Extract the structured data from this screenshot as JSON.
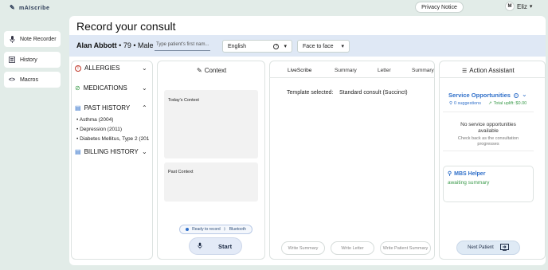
{
  "app": {
    "logo_text": "mAIscribe",
    "privacy_label": "Privacy Notice",
    "user_initial": "M",
    "user_name": "Eliz"
  },
  "sidebar": {
    "items": [
      {
        "label": "Note Recorder",
        "icon": "mic-icon"
      },
      {
        "label": "History",
        "icon": "list-icon"
      },
      {
        "label": "Macros",
        "icon": "code-icon"
      }
    ]
  },
  "page": {
    "title": "Record your consult"
  },
  "patient": {
    "name": "Alan Abbott",
    "details": "• 79 • Male",
    "name_placeholder": "Type patient's first nam...",
    "language": "English",
    "mode": "Face to face"
  },
  "history": {
    "allergies": "ALLERGIES",
    "medications": "MEDICATIONS",
    "past_history": "PAST HISTORY",
    "past_items": [
      "Asthma (2004)",
      "Depression (2011)",
      "Diabetes Mellitus, Type 2 (201"
    ],
    "billing": "BILLING HISTORY"
  },
  "context": {
    "title": "Context",
    "today_label": "Today's Context",
    "past_label": "Past Context",
    "status_ready": "Ready to record",
    "status_bt": "Bluetooth",
    "start_label": "Start"
  },
  "editor": {
    "tabs": [
      "LiveScribe",
      "Summary",
      "Letter",
      "Summary"
    ],
    "template_label": "Template selected:",
    "template_value": "Standard consult (Succinct)",
    "write_summary": "Write Summary",
    "write_letter": "Write Letter",
    "write_patient_summary": "Write Patient Summary"
  },
  "assistant": {
    "title": "Action Assistant",
    "service_title": "Service Opportunities",
    "suggestions": "0 suggestions",
    "uplift": "Total uplift: $0.00",
    "empty_title": "No service opportunities available",
    "empty_sub": "Check back as the consultation progresses",
    "mbs_title": "MBS Helper",
    "mbs_status": "awaiting summary",
    "next_patient": "Next Patient"
  },
  "colors": {
    "accent_blue": "#2f6fc9",
    "accent_green": "#3a9a4a",
    "patient_bar": "#dfe8f5",
    "background": "#e2ece8"
  }
}
